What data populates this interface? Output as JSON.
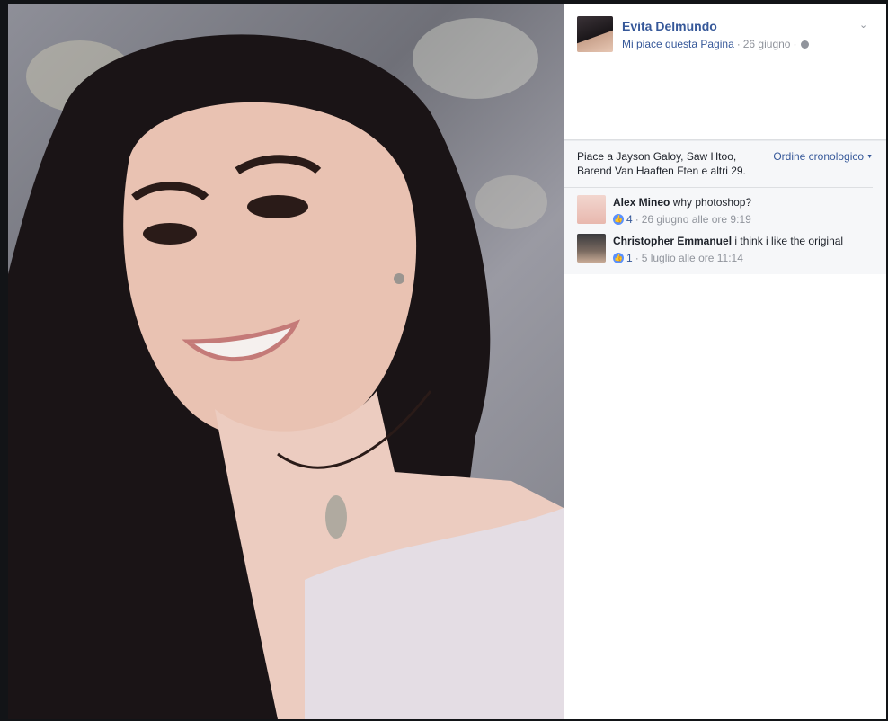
{
  "post": {
    "author": "Evita Delmundo",
    "like_page": "Mi piace questa Pagina",
    "separator": "·",
    "date": "26 giugno",
    "audience_icon": "globe-icon",
    "menu_icon": "chevron-down-icon"
  },
  "reactions": {
    "likes_text": "Piace a Jayson Galoy, Saw Htoo, Barend Van Haaften Ften e altri 29.",
    "order_label": "Ordine cronologico",
    "order_caret_icon": "caret-down-icon"
  },
  "comments": [
    {
      "author": "Alex Mineo",
      "text": "why photoshop?",
      "like_count": "4",
      "time": "26 giugno alle ore 9:19"
    },
    {
      "author": "Christopher Emmanuel",
      "text": "i think i like the original",
      "like_count": "1",
      "time": "5 luglio alle ore 11:14"
    }
  ],
  "colors": {
    "link_blue": "#365899",
    "meta_gray": "#90949c",
    "like_blue": "#5890ff",
    "panel_bg": "#ffffff",
    "reaction_bg": "#f6f7f9"
  }
}
